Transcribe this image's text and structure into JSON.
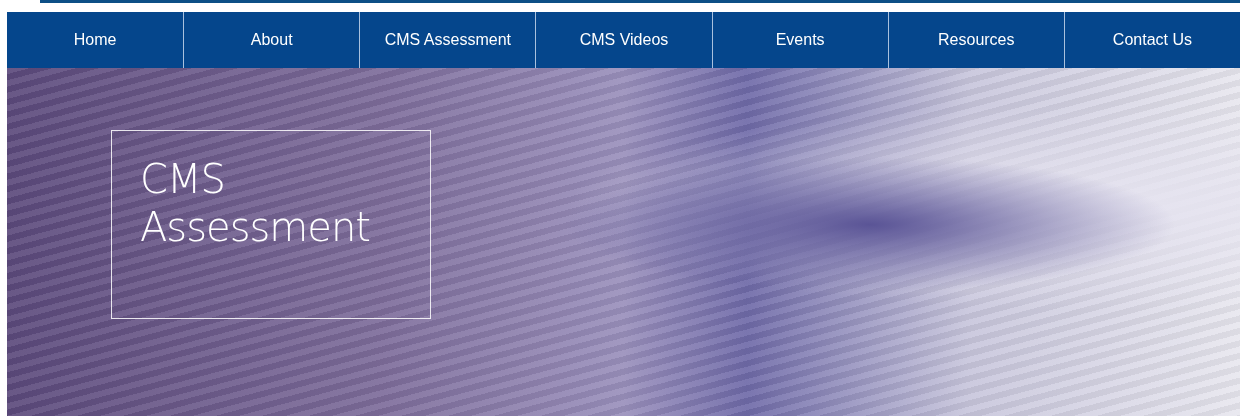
{
  "nav": {
    "items": [
      {
        "label": "Home"
      },
      {
        "label": "About"
      },
      {
        "label": "CMS Assessment"
      },
      {
        "label": "CMS Videos"
      },
      {
        "label": "Events"
      },
      {
        "label": "Resources"
      },
      {
        "label": "Contact Us"
      }
    ]
  },
  "hero": {
    "title_lines": [
      "CMS",
      "Assessment"
    ]
  }
}
